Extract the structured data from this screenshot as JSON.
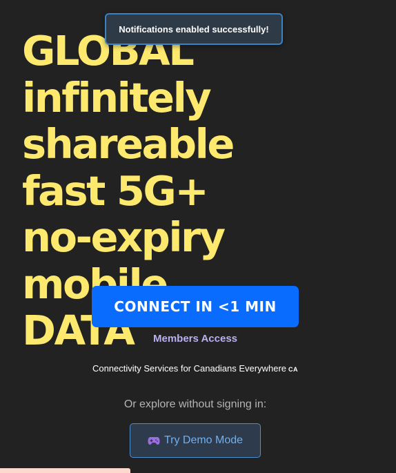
{
  "hero": {
    "lines": [
      "GLOBAL",
      "infinitely",
      "shareable",
      "fast 5G+",
      "no-expiry",
      "mobile",
      "DATA"
    ]
  },
  "toast": {
    "message": "Notifications enabled successfully!"
  },
  "connect_button": {
    "label": "CONNECT IN <1 MIN"
  },
  "members_access": {
    "label": "Members Access"
  },
  "tagline": {
    "text": "Connectivity Services for Canadians Everywhere",
    "badge": "CA"
  },
  "explore": {
    "text": "Or explore without signing in:"
  },
  "demo_button": {
    "label": "Try Demo Mode",
    "icon": "gamepad-icon"
  },
  "colors": {
    "background": "#222222",
    "hero_text": "#fde96e",
    "primary_button": "#0a6cff",
    "members_link": "#b9b0f0",
    "demo_button_text": "#6fb0f2",
    "toast_border": "#3b82c4"
  }
}
